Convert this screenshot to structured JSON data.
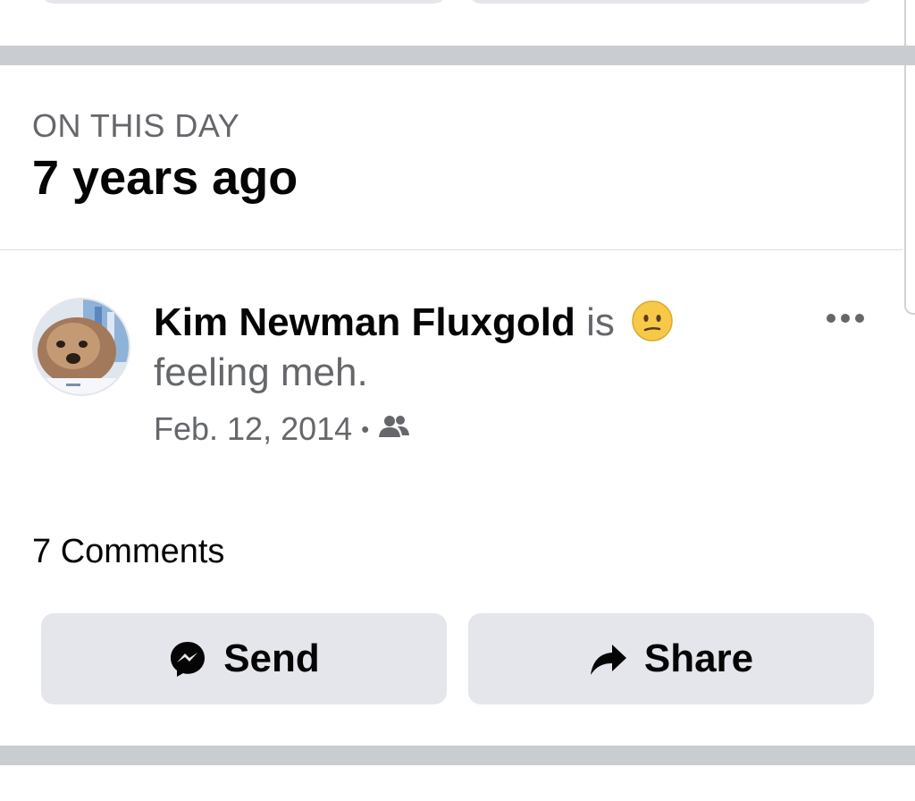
{
  "section": {
    "label": "ON THIS DAY",
    "title": "7 years ago"
  },
  "post": {
    "author": "Kim Newman Fluxgold",
    "verb": "is",
    "feeling": "feeling meh.",
    "emoji_icon": "neutral-face-emoji",
    "date": "Feb. 12, 2014",
    "separator": "•",
    "audience_icon": "friends-icon",
    "more_icon": "more-options-icon"
  },
  "engagement": {
    "comments": "7 Comments"
  },
  "actions": {
    "send_label": "Send",
    "send_icon": "messenger-icon",
    "share_label": "Share",
    "share_icon": "share-arrow-icon"
  },
  "colors": {
    "divider": "#c9ccd1",
    "button_bg": "#e4e6eb",
    "secondary_text": "#65676b",
    "primary_text": "#050505"
  }
}
